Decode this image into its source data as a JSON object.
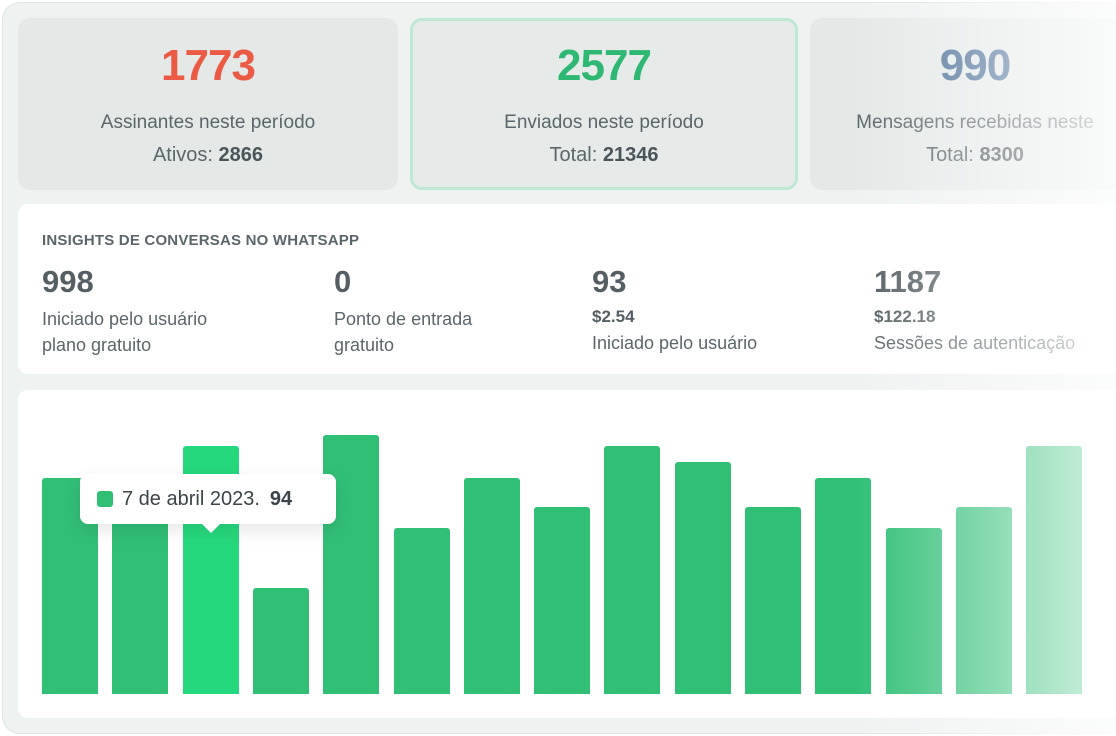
{
  "stats": [
    {
      "value": "1773",
      "label": "Assinantes neste período",
      "sub_label": "Ativos:",
      "sub_value": "2866",
      "color": "#ea5a45"
    },
    {
      "value": "2577",
      "label": "Enviados neste período",
      "sub_label": "Total:",
      "sub_value": "21346",
      "color": "#2fb873"
    },
    {
      "value": "990",
      "label": "Mensagens recebidas neste",
      "sub_label": "Total:",
      "sub_value": "8300",
      "color": "#4a6d96"
    }
  ],
  "insights": {
    "title": "INSIGHTS DE CONVERSAS NO WHATSAPP",
    "items": [
      {
        "value": "998",
        "line1": "Iniciado pelo usuário",
        "line2": "plano gratuito"
      },
      {
        "value": "0",
        "line1": "Ponto de entrada",
        "line2": "gratuito"
      },
      {
        "value": "93",
        "price": "$2.54",
        "line1": "Iniciado pelo usuário"
      },
      {
        "value": "1187",
        "price": "$122.18",
        "line1": "Sessões de autenticação"
      }
    ]
  },
  "chart_data": {
    "type": "bar",
    "values": [
      82,
      82,
      94,
      40,
      98,
      63,
      82,
      71,
      94,
      88,
      71,
      82,
      63,
      71,
      94
    ],
    "highlight_index": 2,
    "color": "#31bf76",
    "highlight_color": "#26d87d",
    "tooltip": {
      "label": "7 de abril 2023.",
      "value": "94"
    }
  }
}
